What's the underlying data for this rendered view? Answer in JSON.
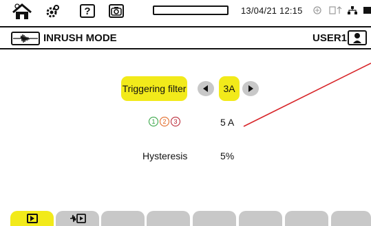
{
  "status_bar": {
    "home_icon": "home-icon",
    "settings_icon": "gear-icon",
    "help_label": "?",
    "camera_icon": "camera-icon",
    "battery_icon": "battery-icon",
    "datetime": "13/04/21 12:15",
    "network_icon": "network-icon",
    "usb_icon": "usb-icon",
    "lan_icon": "lan-icon",
    "memory_icon": "memory-icon"
  },
  "title_bar": {
    "mode_icon": "inrush-waveform-icon",
    "title": "INRUSH MODE",
    "user_label": "USER1",
    "user_icon": "user-icon"
  },
  "settings": {
    "triggering_filter": {
      "label": "Triggering filter",
      "value": "3A",
      "decrement_icon": "arrow-left-icon",
      "increment_icon": "arrow-right-icon"
    },
    "phases": [
      "1",
      "2",
      "3"
    ],
    "current_value": "5 A",
    "hysteresis": {
      "label": "Hysteresis",
      "value": "5%"
    }
  },
  "colors": {
    "accent_yellow": "#f2ea1a",
    "tab_gray": "#c8c8c8",
    "phase1": "#2aa03a",
    "phase2": "#e06018",
    "phase3": "#b51a2a"
  },
  "tabs": [
    {
      "icon": "play-icon",
      "active": true
    },
    {
      "icon": "inrush-play-icon",
      "active": false
    },
    {
      "icon": "",
      "active": false
    },
    {
      "icon": "",
      "active": false
    },
    {
      "icon": "",
      "active": false
    },
    {
      "icon": "",
      "active": false
    },
    {
      "icon": "",
      "active": false
    },
    {
      "icon": "",
      "active": false
    }
  ]
}
